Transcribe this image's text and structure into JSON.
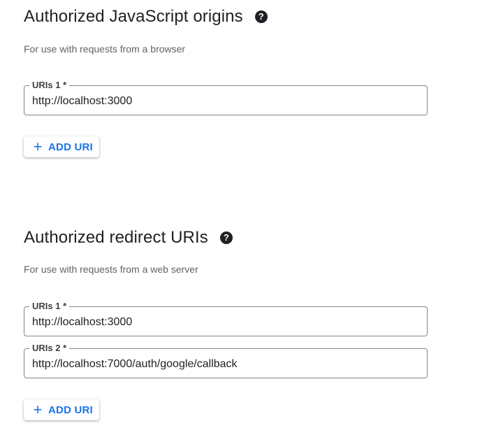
{
  "js_origins": {
    "title": "Authorized JavaScript origins",
    "help_icon": "?",
    "description": "For use with requests from a browser",
    "fields": [
      {
        "label": "URIs 1 *",
        "value": "http://localhost:3000"
      }
    ],
    "add_button": {
      "icon": "+",
      "label": "ADD URI"
    }
  },
  "redirect_uris": {
    "title": "Authorized redirect URIs",
    "help_icon": "?",
    "description": "For use with requests from a web server",
    "fields": [
      {
        "label": "URIs 1 *",
        "value": "http://localhost:3000"
      },
      {
        "label": "URIs 2 *",
        "value": "http://localhost:7000/auth/google/callback"
      }
    ],
    "add_button": {
      "icon": "+",
      "label": "ADD URI"
    }
  },
  "colors": {
    "accent": "#1a73e8",
    "text_primary": "#202124",
    "text_secondary": "#5f6368",
    "border": "#80868b"
  }
}
